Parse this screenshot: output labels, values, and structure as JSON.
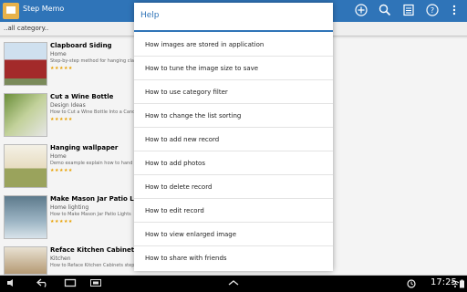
{
  "app": {
    "title": "Step Memo"
  },
  "actionbar": {
    "icons": [
      "add-icon",
      "search-icon",
      "list-icon",
      "help-icon",
      "overflow-menu-icon"
    ]
  },
  "category": {
    "label": "..all category.."
  },
  "list": {
    "items": [
      {
        "title": "Clapboard Siding",
        "category": "Home",
        "desc": "Step-by-step method for hanging cla",
        "stars": "★★★★★"
      },
      {
        "title": "Cut a Wine Bottle",
        "category": "Design Ideas",
        "desc": "How to Cut a Wine Bottle Into a Candl",
        "stars": "★★★★★"
      },
      {
        "title": "Hanging wallpaper",
        "category": "Home",
        "desc": "Demo example explain how to hand w",
        "stars": "★★★★★"
      },
      {
        "title": "Make Mason Jar Patio Lights",
        "category": "Home lighting",
        "desc": "How to Make Mason Jar Patio Lights",
        "stars": "★★★★★"
      },
      {
        "title": "Reface Kitchen Cabinets",
        "category": "Kitchen",
        "desc": "How to Reface Kitchen Cabinets step",
        "stars": "★★★★★"
      }
    ]
  },
  "dialog": {
    "title": "Help",
    "items": [
      "How images are stored in application",
      "How to tune the image size to save",
      "How to use category filter",
      "How to change the list sorting",
      "How to add new record",
      "How to add photos",
      "How to delete record",
      "How to edit record",
      "How to view enlarged image",
      "How to share with friends"
    ]
  },
  "navbar": {
    "time": "17:25"
  },
  "colors": {
    "accent": "#2f74b8",
    "stars": "#e8a000"
  }
}
